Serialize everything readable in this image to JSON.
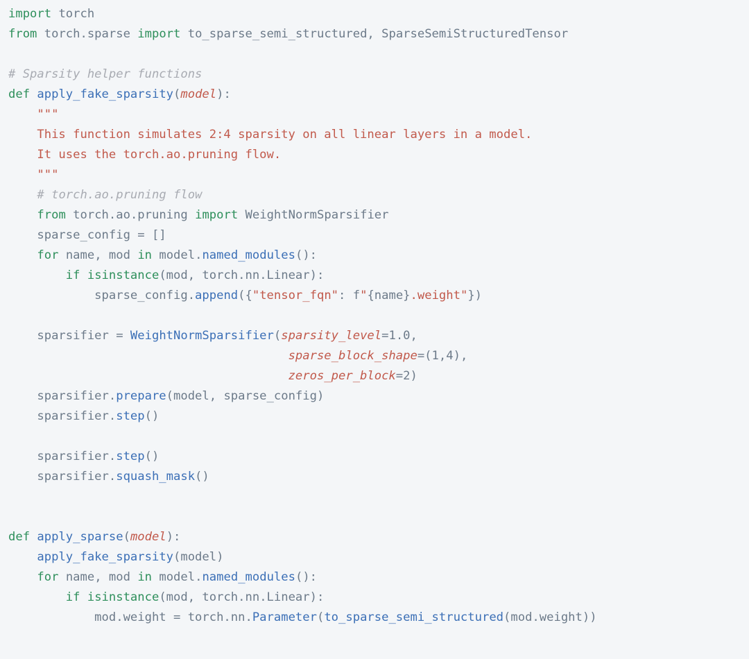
{
  "code": {
    "lines": [
      [
        {
          "t": "import ",
          "c": "kw"
        },
        {
          "t": "torch",
          "c": "name"
        }
      ],
      [
        {
          "t": "from ",
          "c": "kw"
        },
        {
          "t": "torch.sparse",
          "c": "name"
        },
        {
          "t": " ",
          "c": "name"
        },
        {
          "t": "import ",
          "c": "kw"
        },
        {
          "t": "to_sparse_semi_structured, SparseSemiStructuredTensor",
          "c": "name"
        }
      ],
      [],
      [
        {
          "t": "# Sparsity helper functions",
          "c": "cmt"
        }
      ],
      [
        {
          "t": "def ",
          "c": "kw"
        },
        {
          "t": "apply_fake_sparsity",
          "c": "func"
        },
        {
          "t": "(",
          "c": "punc"
        },
        {
          "t": "model",
          "c": "param"
        },
        {
          "t": "):",
          "c": "punc"
        }
      ],
      [
        {
          "t": "    ",
          "c": "name"
        },
        {
          "t": "\"\"\"",
          "c": "doc"
        }
      ],
      [
        {
          "t": "    This function simulates 2:4 sparsity on all linear layers in a model.",
          "c": "doc"
        }
      ],
      [
        {
          "t": "    It uses the torch.ao.pruning flow.",
          "c": "doc"
        }
      ],
      [
        {
          "t": "    \"\"\"",
          "c": "doc"
        }
      ],
      [
        {
          "t": "    ",
          "c": "name"
        },
        {
          "t": "# torch.ao.pruning flow",
          "c": "cmt"
        }
      ],
      [
        {
          "t": "    ",
          "c": "name"
        },
        {
          "t": "from ",
          "c": "kw"
        },
        {
          "t": "torch.ao.pruning",
          "c": "name"
        },
        {
          "t": " ",
          "c": "name"
        },
        {
          "t": "import ",
          "c": "kw"
        },
        {
          "t": "WeightNormSparsifier",
          "c": "name"
        }
      ],
      [
        {
          "t": "    sparse_config = []",
          "c": "name"
        }
      ],
      [
        {
          "t": "    ",
          "c": "name"
        },
        {
          "t": "for ",
          "c": "kw"
        },
        {
          "t": "name, mod",
          "c": "name"
        },
        {
          "t": " ",
          "c": "name"
        },
        {
          "t": "in ",
          "c": "kw"
        },
        {
          "t": "model.",
          "c": "name"
        },
        {
          "t": "named_modules",
          "c": "call"
        },
        {
          "t": "():",
          "c": "punc"
        }
      ],
      [
        {
          "t": "        ",
          "c": "name"
        },
        {
          "t": "if ",
          "c": "kw"
        },
        {
          "t": "isinstance",
          "c": "builtin"
        },
        {
          "t": "(mod, torch.nn.Linear):",
          "c": "name"
        }
      ],
      [
        {
          "t": "            sparse_config.",
          "c": "name"
        },
        {
          "t": "append",
          "c": "call"
        },
        {
          "t": "({",
          "c": "punc"
        },
        {
          "t": "\"tensor_fqn\"",
          "c": "str"
        },
        {
          "t": ": f",
          "c": "name"
        },
        {
          "t": "\"",
          "c": "str"
        },
        {
          "t": "{name}",
          "c": "name"
        },
        {
          "t": ".weight\"",
          "c": "str"
        },
        {
          "t": "})",
          "c": "punc"
        }
      ],
      [],
      [
        {
          "t": "    sparsifier = ",
          "c": "name"
        },
        {
          "t": "WeightNormSparsifier",
          "c": "call"
        },
        {
          "t": "(",
          "c": "punc"
        },
        {
          "t": "sparsity_level",
          "c": "param"
        },
        {
          "t": "=",
          "c": "op"
        },
        {
          "t": "1.0",
          "c": "num"
        },
        {
          "t": ",",
          "c": "punc"
        }
      ],
      [
        {
          "t": "                                       ",
          "c": "name"
        },
        {
          "t": "sparse_block_shape",
          "c": "param"
        },
        {
          "t": "=(",
          "c": "punc"
        },
        {
          "t": "1",
          "c": "num"
        },
        {
          "t": ",",
          "c": "punc"
        },
        {
          "t": "4",
          "c": "num"
        },
        {
          "t": "),",
          "c": "punc"
        }
      ],
      [
        {
          "t": "                                       ",
          "c": "name"
        },
        {
          "t": "zeros_per_block",
          "c": "param"
        },
        {
          "t": "=",
          "c": "op"
        },
        {
          "t": "2",
          "c": "num"
        },
        {
          "t": ")",
          "c": "punc"
        }
      ],
      [
        {
          "t": "    sparsifier.",
          "c": "name"
        },
        {
          "t": "prepare",
          "c": "call"
        },
        {
          "t": "(model, sparse_config)",
          "c": "name"
        }
      ],
      [
        {
          "t": "    sparsifier.",
          "c": "name"
        },
        {
          "t": "step",
          "c": "call"
        },
        {
          "t": "()",
          "c": "punc"
        }
      ],
      [],
      [
        {
          "t": "    sparsifier.",
          "c": "name"
        },
        {
          "t": "step",
          "c": "call"
        },
        {
          "t": "()",
          "c": "punc"
        }
      ],
      [
        {
          "t": "    sparsifier.",
          "c": "name"
        },
        {
          "t": "squash_mask",
          "c": "call"
        },
        {
          "t": "()",
          "c": "punc"
        }
      ],
      [],
      [],
      [
        {
          "t": "def ",
          "c": "kw"
        },
        {
          "t": "apply_sparse",
          "c": "func"
        },
        {
          "t": "(",
          "c": "punc"
        },
        {
          "t": "model",
          "c": "param"
        },
        {
          "t": "):",
          "c": "punc"
        }
      ],
      [
        {
          "t": "    ",
          "c": "name"
        },
        {
          "t": "apply_fake_sparsity",
          "c": "call"
        },
        {
          "t": "(model)",
          "c": "name"
        }
      ],
      [
        {
          "t": "    ",
          "c": "name"
        },
        {
          "t": "for ",
          "c": "kw"
        },
        {
          "t": "name, mod",
          "c": "name"
        },
        {
          "t": " ",
          "c": "name"
        },
        {
          "t": "in ",
          "c": "kw"
        },
        {
          "t": "model.",
          "c": "name"
        },
        {
          "t": "named_modules",
          "c": "call"
        },
        {
          "t": "():",
          "c": "punc"
        }
      ],
      [
        {
          "t": "        ",
          "c": "name"
        },
        {
          "t": "if ",
          "c": "kw"
        },
        {
          "t": "isinstance",
          "c": "builtin"
        },
        {
          "t": "(mod, torch.nn.Linear):",
          "c": "name"
        }
      ],
      [
        {
          "t": "            mod.weight = torch.nn.",
          "c": "name"
        },
        {
          "t": "Parameter",
          "c": "call"
        },
        {
          "t": "(",
          "c": "punc"
        },
        {
          "t": "to_sparse_semi_structured",
          "c": "call"
        },
        {
          "t": "(mod.weight))",
          "c": "name"
        }
      ]
    ]
  }
}
